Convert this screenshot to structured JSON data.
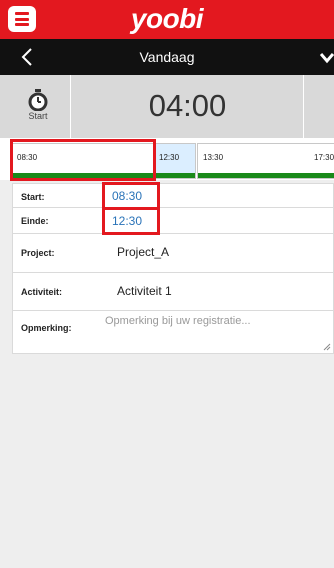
{
  "app": {
    "logo": "yoobi"
  },
  "nav": {
    "title": "Vandaag"
  },
  "timer": {
    "stopwatch_label": "Start",
    "value": "04:00"
  },
  "timeline": [
    {
      "time": "08:30",
      "selected": false
    },
    {
      "time": "12:30",
      "selected": true
    },
    {
      "time": "13:30",
      "selected": false
    },
    {
      "time": "17:30",
      "selected": false
    }
  ],
  "form": {
    "start_label": "Start:",
    "start_value": "08:30",
    "end_label": "Einde:",
    "end_value": "12:30",
    "project_label": "Project:",
    "project_value": "Project_A",
    "activity_label": "Activiteit:",
    "activity_value": "Activiteit 1",
    "remark_label": "Opmerking:",
    "remark_placeholder": "Opmerking bij uw registratie..."
  },
  "colors": {
    "brand_red": "#e3181f",
    "nav_black": "#111111",
    "link_blue": "#2a73b8",
    "timeline_green": "#1a8a1a"
  }
}
